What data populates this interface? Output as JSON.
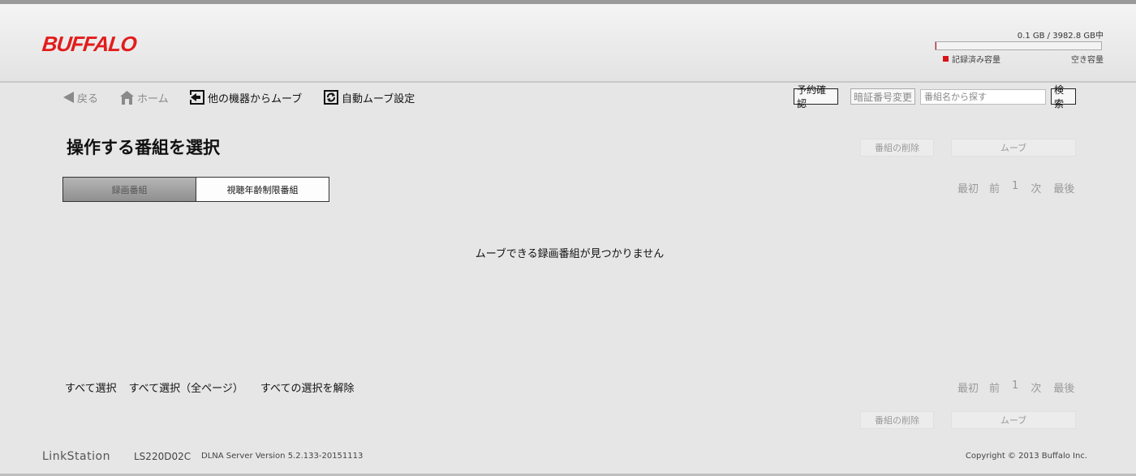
{
  "header": {
    "logo": "BUFFALO",
    "capacity": {
      "text": "0.1 GB / 3982.8 GB中",
      "used_fraction": 3e-05,
      "used_label": "記録済み容量",
      "free_label": "空き容量",
      "used_color": "#d8141a"
    }
  },
  "nav": {
    "back": "戻る",
    "home": "ホーム",
    "move_from_other": "他の機器からムーブ",
    "auto_move": "自動ムーブ設定",
    "reserve_button": "予約確認",
    "pin_button": "暗証番号変更",
    "search_placeholder": "番組名から探す",
    "search_value": "",
    "search_button": "検索"
  },
  "main": {
    "title": "操作する番組を選択",
    "delete_button": "番組の削除",
    "move_button": "ムーブ",
    "tabs": [
      {
        "label": "録画番組",
        "active": true
      },
      {
        "label": "視聴年齢制限番組",
        "active": false
      }
    ],
    "pager": {
      "first": "最初",
      "prev": "前",
      "page": "1",
      "next": "次",
      "last": "最後"
    },
    "empty_message": "ムーブできる録画番組が見つかりません",
    "select_all": "すべて選択",
    "select_all_pages": "すべて選択（全ページ）",
    "deselect_all": "すべての選択を解除"
  },
  "footer": {
    "brand": "LinkStation",
    "model": "LS220D02C",
    "dlna": "DLNA Server Version 5.2.133-20151113",
    "copyright": "Copyright © 2013 Buffalo Inc."
  },
  "icons": {
    "back": "back-arrow-icon",
    "home": "home-icon",
    "move": "move-device-icon",
    "auto_move": "auto-move-icon"
  },
  "colors": {
    "brand": "#e21c1c",
    "background": "#e6e6e6"
  }
}
